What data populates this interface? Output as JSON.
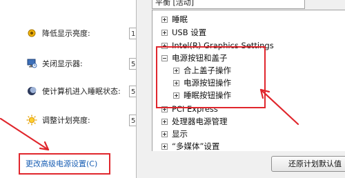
{
  "left_panel": {
    "settings": [
      {
        "icon": "brightness-dim-icon",
        "label": "降低显示亮度:",
        "box_value": "1"
      },
      {
        "icon": "monitor-off-icon",
        "label": "关闭显示器:",
        "box_value": "5"
      },
      {
        "icon": "moon-sleep-icon",
        "label": "使计算机进入睡眠状态:",
        "box_value": "5"
      },
      {
        "icon": "sun-brightness-icon",
        "label": "调整计划亮度:",
        "box_value": "5"
      }
    ],
    "advanced_link": "更改高级电源设置(C)"
  },
  "dialog": {
    "plan_combo": "平衡 [活动]",
    "tree_items": [
      {
        "label": "睡眠",
        "expanded": false,
        "level": 0
      },
      {
        "label": "USB 设置",
        "expanded": false,
        "level": 0
      },
      {
        "label": "Intel(R) Graphics Settings",
        "expanded": false,
        "level": 0
      },
      {
        "label": "电源按钮和盖子",
        "expanded": true,
        "level": 0
      },
      {
        "label": "合上盖子操作",
        "expanded": false,
        "level": 1
      },
      {
        "label": "电源按钮操作",
        "expanded": false,
        "level": 1
      },
      {
        "label": "睡眠按钮操作",
        "expanded": false,
        "level": 1
      },
      {
        "label": "PCI Express",
        "expanded": false,
        "level": 0
      },
      {
        "label": "处理器电源管理",
        "expanded": false,
        "level": 0
      },
      {
        "label": "显示",
        "expanded": false,
        "level": 0
      },
      {
        "label": "“多媒体”设置",
        "expanded": false,
        "level": 0
      }
    ],
    "restore_button": "还原计划默认值"
  },
  "annotation_color": "#e0262c"
}
